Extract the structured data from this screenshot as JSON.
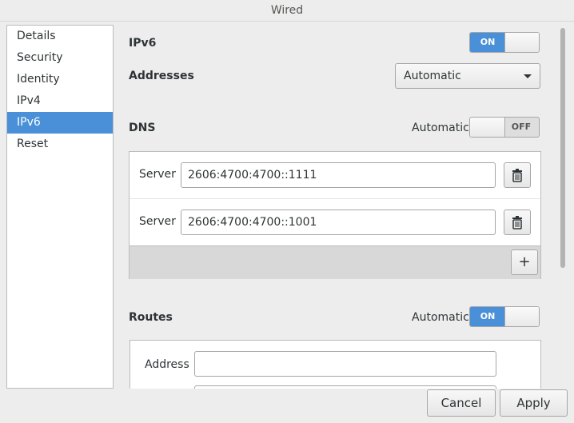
{
  "window": {
    "title": "Wired"
  },
  "sidebar": {
    "items": [
      {
        "label": "Details"
      },
      {
        "label": "Security"
      },
      {
        "label": "Identity"
      },
      {
        "label": "IPv4"
      },
      {
        "label": "IPv6",
        "selected": true
      },
      {
        "label": "Reset"
      }
    ]
  },
  "ipv6": {
    "label": "IPv6",
    "switch": {
      "state": "ON"
    },
    "addresses_label": "Addresses",
    "addresses_value": "Automatic"
  },
  "dns": {
    "label": "DNS",
    "automatic_label": "Automatic",
    "switch": {
      "state": "OFF"
    },
    "servers": [
      {
        "label": "Server",
        "value": "2606:4700:4700::1111"
      },
      {
        "label": "Server",
        "value": "2606:4700:4700::1001"
      }
    ],
    "add_label": "+"
  },
  "routes": {
    "label": "Routes",
    "automatic_label": "Automatic",
    "switch": {
      "state": "ON"
    },
    "address_label": "Address",
    "address_value": ""
  },
  "buttons": {
    "cancel": "Cancel",
    "apply": "Apply"
  },
  "colors": {
    "accent": "#4a90d9"
  }
}
